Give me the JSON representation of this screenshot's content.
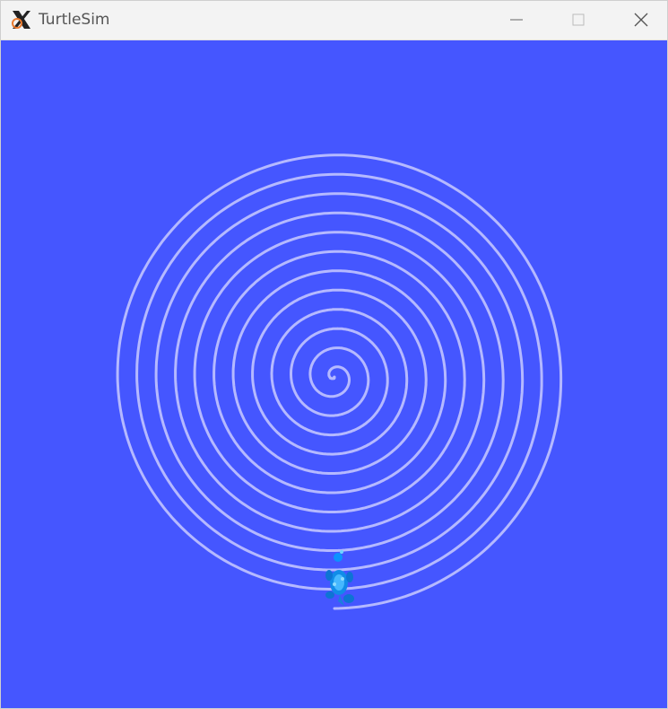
{
  "window": {
    "title": "TurtleSim"
  },
  "titlebar": {
    "icons": {
      "app": "xorg-x-icon",
      "minimize": "minimize-icon",
      "maximize": "maximize-icon",
      "close": "close-icon"
    }
  },
  "canvas": {
    "background_color": "#4556ff",
    "trail_color": "#b5b9ff",
    "trail_shape": "spiral",
    "spiral_turns": 12
  },
  "turtle": {
    "color": "#1e9ff0",
    "icon": "turtle-icon"
  }
}
